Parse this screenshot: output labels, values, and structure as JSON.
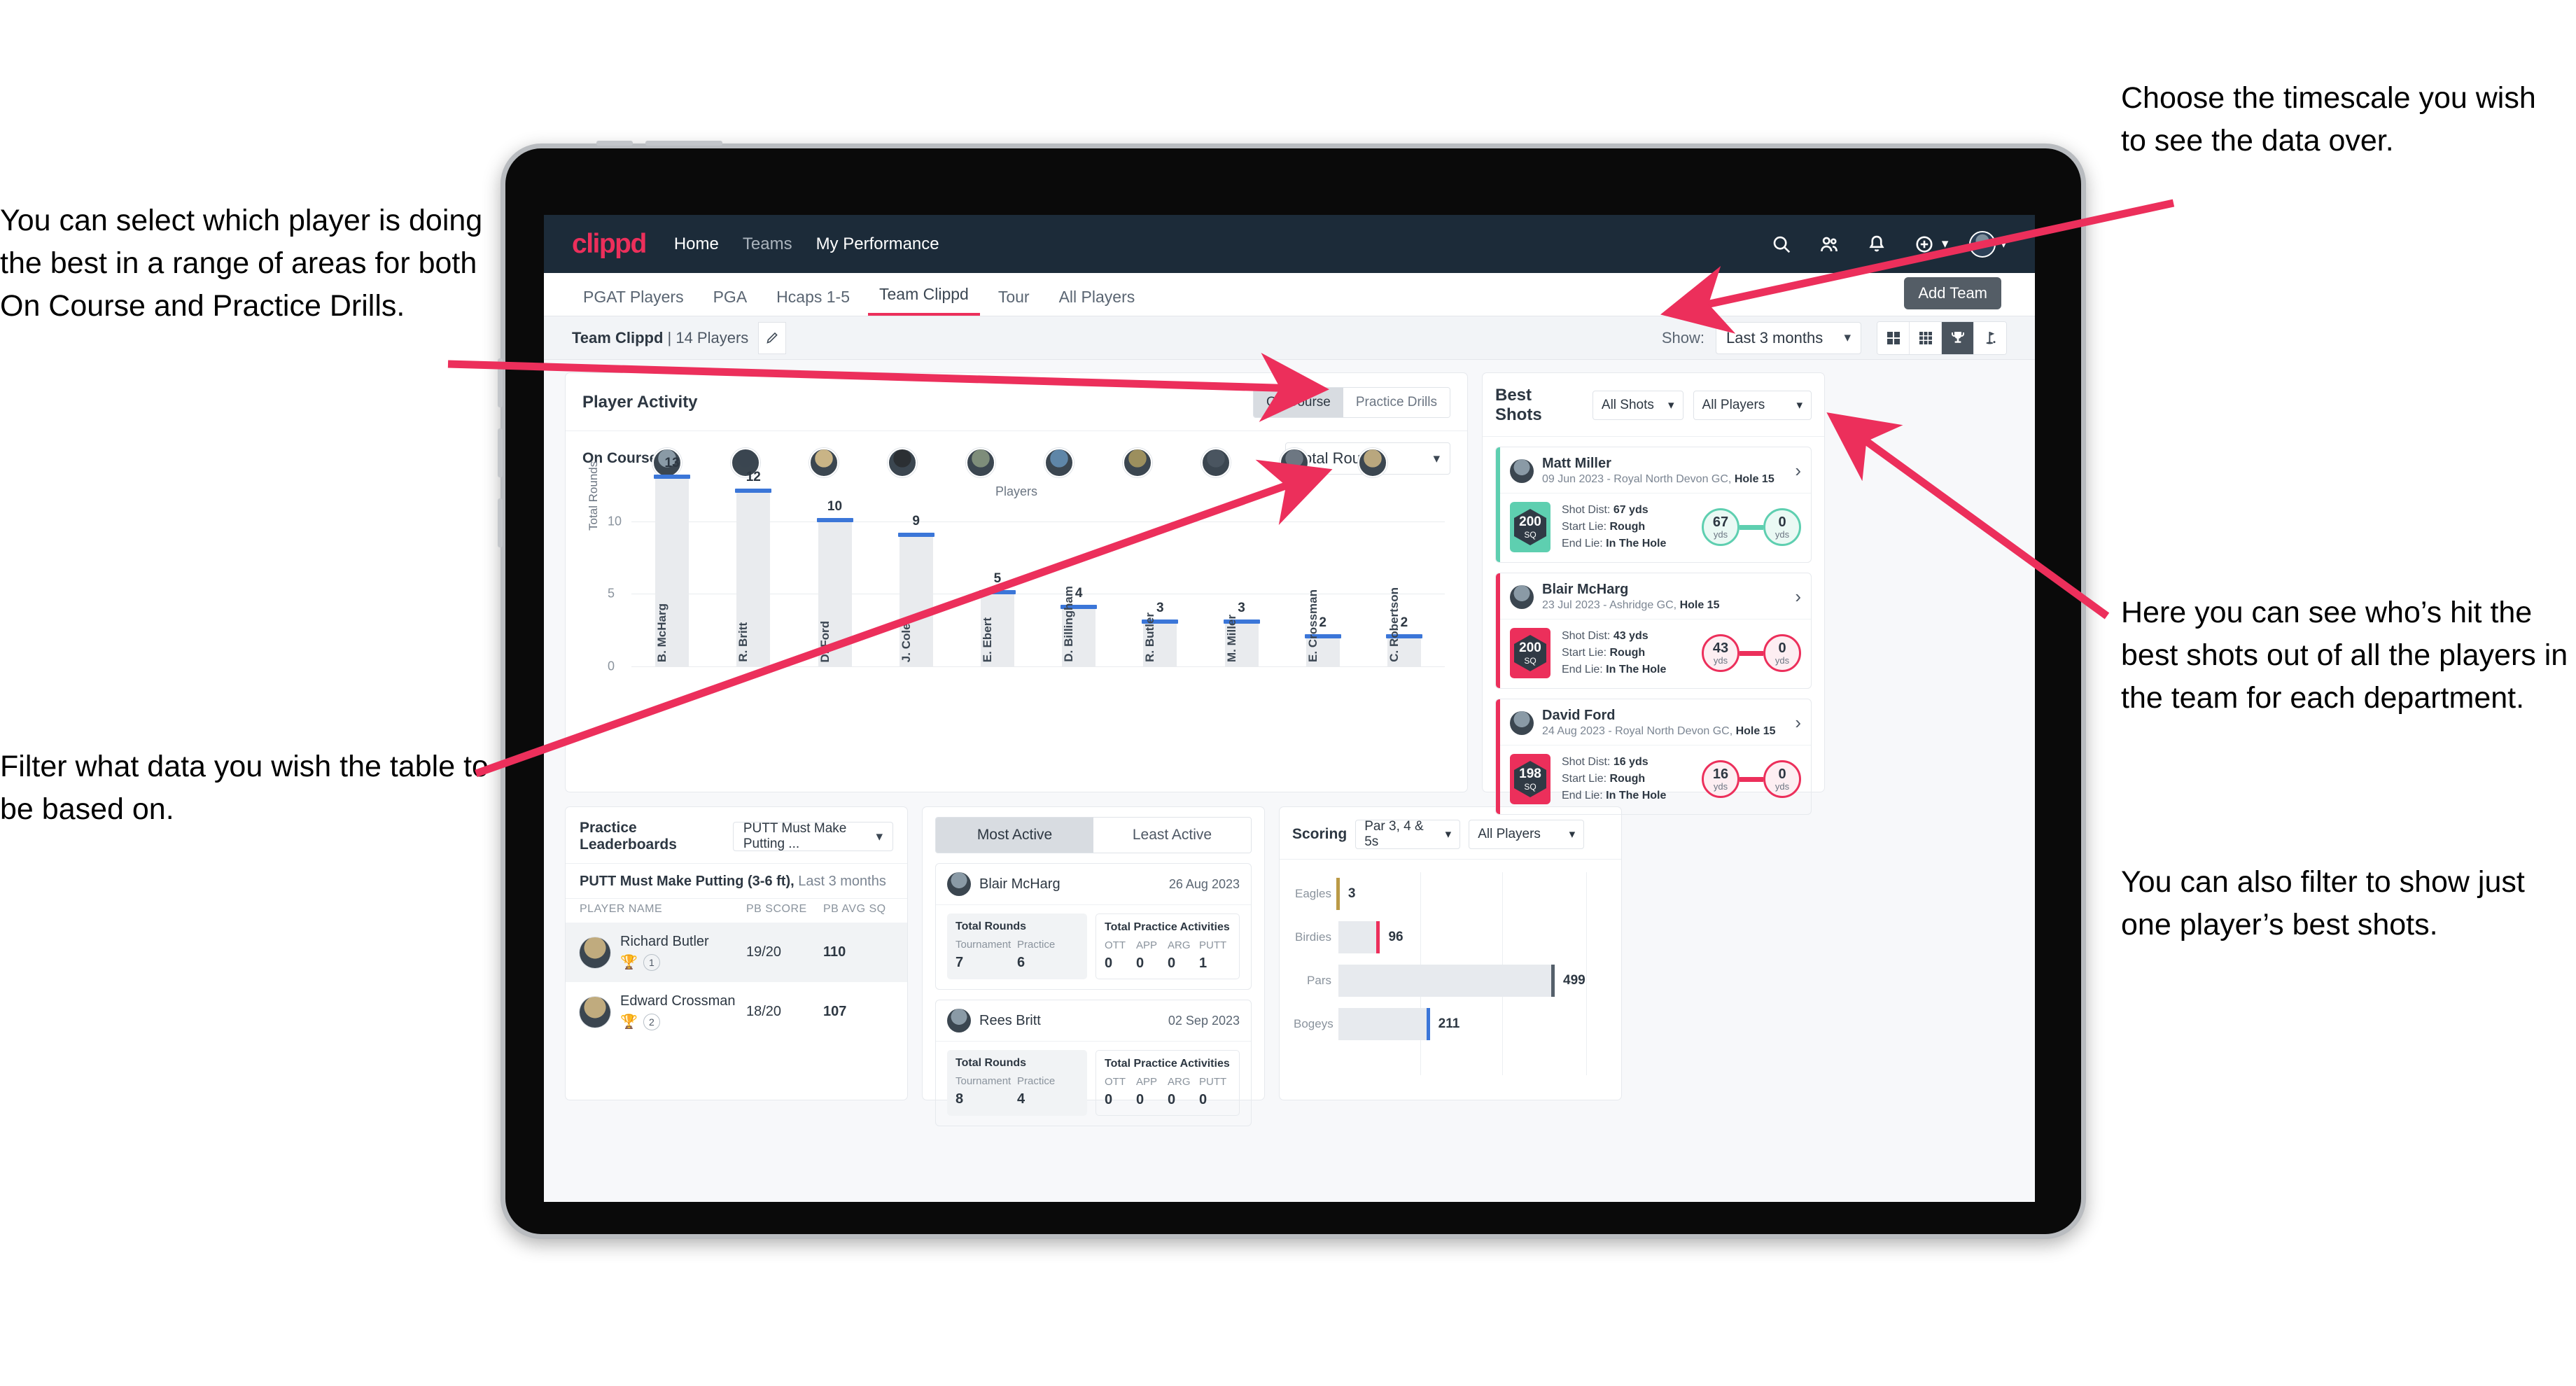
{
  "annotations": {
    "left_top": "You can select which player is doing the best in a range of areas for both On Course and Practice Drills.",
    "left_bottom": "Filter what data you wish the table to be based on.",
    "right_top": "Choose the timescale you wish to see the data over.",
    "right_mid": "Here you can see who’s hit the best shots out of all the players in the team for each department.",
    "right_bottom": "You can also filter to show just one player’s best shots."
  },
  "topnav": {
    "logo": "clippd",
    "links": [
      {
        "label": "Home",
        "dim": false
      },
      {
        "label": "Teams",
        "dim": true
      },
      {
        "label": "My Performance",
        "dim": false
      }
    ],
    "icons": [
      "search-icon",
      "people-icon",
      "bell-icon",
      "plus-circle-icon",
      "avatar-icon"
    ]
  },
  "tabbar": {
    "tabs": [
      {
        "label": "PGAT Players",
        "active": false
      },
      {
        "label": "PGA",
        "active": false
      },
      {
        "label": "Hcaps 1-5",
        "active": false
      },
      {
        "label": "Team Clippd",
        "active": true
      },
      {
        "label": "Tour",
        "active": false
      },
      {
        "label": "All Players",
        "active": false
      }
    ],
    "tooltip": "Add Team"
  },
  "subbar": {
    "team_name": "Team Clippd",
    "team_count": "| 14 Players",
    "edit_icon": "pencil-icon",
    "show_label": "Show:",
    "show_value": "Last 3 months",
    "view_toggles": [
      {
        "icon": "grid-2x2-icon",
        "active": false
      },
      {
        "icon": "grid-3x3-icon",
        "active": false
      },
      {
        "icon": "trophy-icon",
        "active": true
      },
      {
        "icon": "golf-flag-icon",
        "active": false
      }
    ]
  },
  "activity": {
    "title": "Player Activity",
    "segments": [
      {
        "label": "On Course",
        "active": true
      },
      {
        "label": "Practice Drills",
        "active": false
      }
    ],
    "sub_label": "On Course",
    "metric_select": "Total Rounds"
  },
  "chart_data": [
    {
      "type": "bar",
      "title": "Player Activity – On Course",
      "categories": [
        "B. McHarg",
        "R. Britt",
        "D. Ford",
        "J. Coles",
        "E. Ebert",
        "D. Billingham",
        "R. Butler",
        "M. Miller",
        "E. Crossman",
        "C. Robertson"
      ],
      "values": [
        13,
        12,
        10,
        9,
        5,
        4,
        3,
        3,
        2,
        2
      ],
      "xlabel": "Players",
      "ylabel": "Total Rounds",
      "yticks": [
        0,
        5,
        10
      ],
      "ylim": [
        0,
        14
      ],
      "grid": true,
      "legend": "none",
      "bar_color": "#e9ebee",
      "cap_color": "#3b76d8"
    },
    {
      "type": "bar",
      "orientation": "horizontal",
      "title": "Scoring",
      "categories": [
        "Eagles",
        "Birdies",
        "Pars",
        "Bogeys"
      ],
      "values": [
        3,
        96,
        499,
        211
      ],
      "xlabel": "",
      "ylabel": "",
      "xlim": [
        0,
        620
      ],
      "grid": true,
      "legend": "none",
      "tip_colors": [
        "#bb9a46",
        "#ec2f5b",
        "#55606b",
        "#3b76d8"
      ]
    }
  ],
  "best_shots": {
    "title": "Best Shots",
    "shot_filter": "All Shots",
    "player_filter": "All Players",
    "cards": [
      {
        "player": "Matt Miller",
        "meta_date": "09 Jun 2023 - Royal North Devon GC,",
        "meta_hole": "Hole 15",
        "sq_value": "200",
        "sq_unit": "SQ",
        "accent": "#5ecfb0",
        "shot_dist_label": "Shot Dist:",
        "shot_dist": "67 yds",
        "start_lie_label": "Start Lie:",
        "start_lie": "Rough",
        "end_lie_label": "End Lie:",
        "end_lie": "In The Hole",
        "from_value": "67",
        "from_unit": "yds",
        "to_value": "0",
        "to_unit": "yds"
      },
      {
        "player": "Blair McHarg",
        "meta_date": "23 Jul 2023 - Ashridge GC,",
        "meta_hole": "Hole 15",
        "sq_value": "200",
        "sq_unit": "SQ",
        "accent": "#ec2f5b",
        "shot_dist_label": "Shot Dist:",
        "shot_dist": "43 yds",
        "start_lie_label": "Start Lie:",
        "start_lie": "Rough",
        "end_lie_label": "End Lie:",
        "end_lie": "In The Hole",
        "from_value": "43",
        "from_unit": "yds",
        "to_value": "0",
        "to_unit": "yds"
      },
      {
        "player": "David Ford",
        "meta_date": "24 Aug 2023 - Royal North Devon GC,",
        "meta_hole": "Hole 15",
        "sq_value": "198",
        "sq_unit": "SQ",
        "accent": "#ec2f5b",
        "shot_dist_label": "Shot Dist:",
        "shot_dist": "16 yds",
        "start_lie_label": "Start Lie:",
        "start_lie": "Rough",
        "end_lie_label": "End Lie:",
        "end_lie": "In The Hole",
        "from_value": "16",
        "from_unit": "yds",
        "to_value": "0",
        "to_unit": "yds"
      }
    ]
  },
  "practice": {
    "title": "Practice Leaderboards",
    "drill_select": "PUTT Must Make Putting ...",
    "drill_name": "PUTT Must Make Putting (3-6 ft),",
    "drill_period": "Last 3 months",
    "columns": [
      "PLAYER NAME",
      "PB SCORE",
      "PB AVG SQ"
    ],
    "rows": [
      {
        "name": "Richard Butler",
        "rank": "1",
        "trophy": "gold",
        "pb_score": "19/20",
        "pb_avg_sq": "110"
      },
      {
        "name": "Edward Crossman",
        "rank": "2",
        "trophy": "silver",
        "pb_score": "18/20",
        "pb_avg_sq": "107"
      }
    ]
  },
  "active_panel": {
    "tabs": [
      {
        "label": "Most Active",
        "active": true
      },
      {
        "label": "Least Active",
        "active": false
      }
    ],
    "cards": [
      {
        "player": "Blair McHarg",
        "date": "26 Aug 2023",
        "rounds_title": "Total Rounds",
        "rounds_keys": [
          "Tournament",
          "Practice"
        ],
        "rounds_values": [
          "7",
          "6"
        ],
        "practice_title": "Total Practice Activities",
        "practice_keys": [
          "OTT",
          "APP",
          "ARG",
          "PUTT"
        ],
        "practice_values": [
          "0",
          "0",
          "0",
          "1"
        ]
      },
      {
        "player": "Rees Britt",
        "date": "02 Sep 2023",
        "rounds_title": "Total Rounds",
        "rounds_keys": [
          "Tournament",
          "Practice"
        ],
        "rounds_values": [
          "8",
          "4"
        ],
        "practice_title": "Total Practice Activities",
        "practice_keys": [
          "OTT",
          "APP",
          "ARG",
          "PUTT"
        ],
        "practice_values": [
          "0",
          "0",
          "0",
          "0"
        ]
      }
    ]
  },
  "scoring": {
    "title": "Scoring",
    "par_filter": "Par 3, 4 & 5s",
    "player_filter": "All Players"
  },
  "colors": {
    "brand_pink": "#ec2f5b",
    "nav_dark": "#1c2b39",
    "bar_blue": "#3b76d8",
    "teal": "#5ecfb0"
  }
}
